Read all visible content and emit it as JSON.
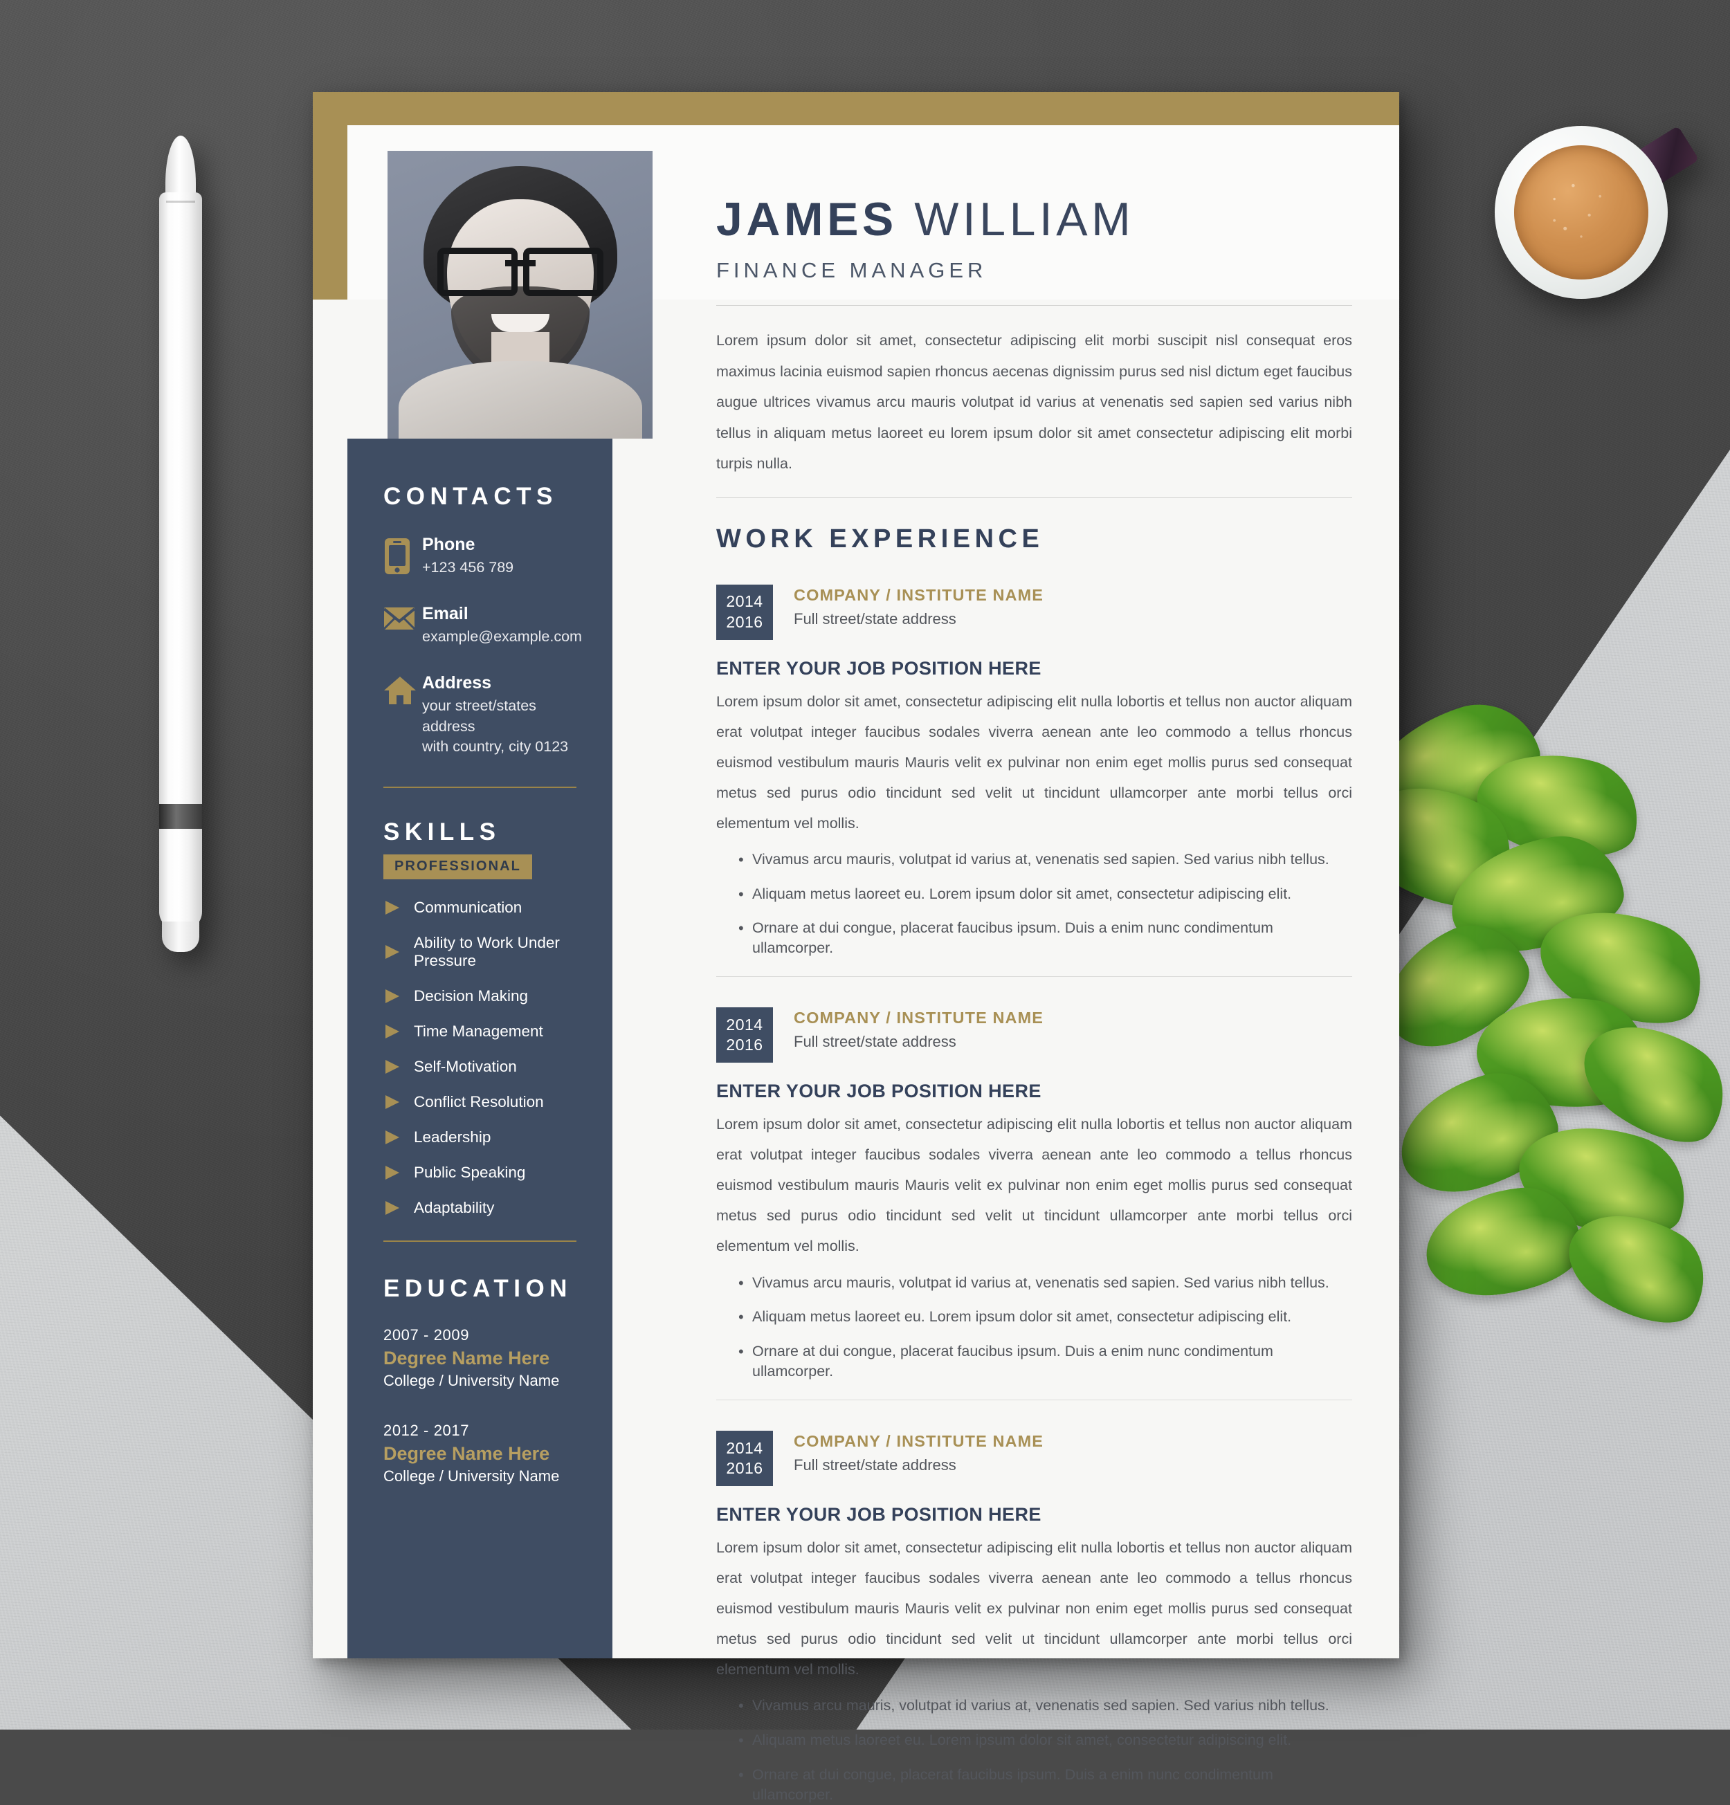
{
  "scene": {
    "objects": [
      {
        "name": "stylus",
        "color": "#ffffff"
      },
      {
        "name": "coffee-cup",
        "color": "#ffffff",
        "handle_color": "#3a2337",
        "coffee_color": "#c9894a"
      },
      {
        "name": "pothos-plant",
        "color": "#4a9620"
      }
    ],
    "desk_dark_color": "#474747",
    "desk_light_color": "#cfd1d2"
  },
  "resume": {
    "colors": {
      "gold": "#a89055",
      "navy": "#3f4d63",
      "heading_navy": "#34415a",
      "paper": "#f7f7f5",
      "body_text": "#53565c"
    },
    "header": {
      "name_first": "JAMES",
      "name_last": "WILLIAM",
      "job_title": "FINANCE MANAGER",
      "photo_alt": "portrait-photo"
    },
    "summary": "Lorem ipsum dolor sit amet, consectetur adipiscing elit morbi suscipit nisl consequat eros maximus lacinia euismod sapien rhoncus aecenas dignissim purus sed nisl dictum eget faucibus augue ultrices vivamus arcu mauris volutpat id varius at venenatis sed sapien sed varius nibh tellus in aliquam metus laoreet eu lorem ipsum dolor sit amet consectetur adipiscing elit morbi turpis nulla.",
    "sidebar": {
      "contacts": {
        "heading": "CONTACTS",
        "items": [
          {
            "icon": "phone-icon",
            "label": "Phone",
            "value": "+123 456 789"
          },
          {
            "icon": "envelope-icon",
            "label": "Email",
            "value": "example@example.com"
          },
          {
            "icon": "home-icon",
            "label": "Address",
            "value": "your street/states address\nwith country, city 0123"
          }
        ]
      },
      "skills": {
        "heading": "SKILLS",
        "tag": "PROFESSIONAL",
        "items": [
          "Communication",
          "Ability to Work Under Pressure",
          "Decision Making",
          "Time Management",
          "Self-Motivation",
          "Conflict Resolution",
          "Leadership",
          "Public Speaking",
          "Adaptability"
        ]
      },
      "education": {
        "heading": "EDUCATION",
        "items": [
          {
            "years": "2007 - 2009",
            "degree": "Degree Name Here",
            "school": "College / University Name"
          },
          {
            "years": "2012 - 2017",
            "degree": "Degree Name Here",
            "school": "College / University Name"
          }
        ]
      }
    },
    "work": {
      "heading": "WORK EXPERIENCE",
      "entries": [
        {
          "year_start": "2014",
          "year_end": "2016",
          "company": "COMPANY / INSTITUTE NAME",
          "address": "Full street/state address",
          "position": "ENTER YOUR JOB POSITION HERE",
          "body": "Lorem ipsum dolor sit amet, consectetur adipiscing elit nulla lobortis et tellus non auctor aliquam erat volutpat integer faucibus sodales viverra aenean ante leo commodo a tellus rhoncus euismod vestibulum mauris Mauris velit ex pulvinar non enim eget mollis purus sed consequat metus sed purus odio tincidunt sed velit ut tincidunt ullamcorper ante morbi tellus orci elementum vel mollis.",
          "bullets": [
            "Vivamus arcu mauris, volutpat id varius at, venenatis sed sapien. Sed varius nibh tellus.",
            "Aliquam metus laoreet eu. Lorem ipsum dolor sit amet, consectetur adipiscing elit.",
            "Ornare at dui congue, placerat faucibus ipsum. Duis a enim nunc condimentum ullamcorper."
          ]
        },
        {
          "year_start": "2014",
          "year_end": "2016",
          "company": "COMPANY / INSTITUTE NAME",
          "address": "Full street/state address",
          "position": "ENTER YOUR JOB POSITION HERE",
          "body": "Lorem ipsum dolor sit amet, consectetur adipiscing elit nulla lobortis et tellus non auctor aliquam erat volutpat integer faucibus sodales viverra aenean ante leo commodo a tellus rhoncus euismod vestibulum mauris Mauris velit ex pulvinar non enim eget mollis purus sed consequat metus sed purus odio tincidunt sed velit ut tincidunt ullamcorper ante morbi tellus orci elementum vel mollis.",
          "bullets": [
            "Vivamus arcu mauris, volutpat id varius at, venenatis sed sapien. Sed varius nibh tellus.",
            "Aliquam metus laoreet eu. Lorem ipsum dolor sit amet, consectetur adipiscing elit.",
            "Ornare at dui congue, placerat faucibus ipsum. Duis a enim nunc condimentum ullamcorper."
          ]
        },
        {
          "year_start": "2014",
          "year_end": "2016",
          "company": "COMPANY / INSTITUTE NAME",
          "address": "Full street/state address",
          "position": "ENTER YOUR JOB POSITION HERE",
          "body": "Lorem ipsum dolor sit amet, consectetur adipiscing elit nulla lobortis et tellus non auctor aliquam erat volutpat integer faucibus sodales viverra aenean ante leo commodo a tellus rhoncus euismod vestibulum mauris Mauris velit ex pulvinar non enim eget mollis purus sed consequat metus sed purus odio tincidunt sed velit ut tincidunt ullamcorper ante morbi tellus orci elementum vel mollis.",
          "bullets": [
            "Vivamus arcu mauris, volutpat id varius at, venenatis sed sapien. Sed varius nibh tellus.",
            "Aliquam metus laoreet eu. Lorem ipsum dolor sit amet, consectetur adipiscing elit.",
            "Ornare at dui congue, placerat faucibus ipsum. Duis a enim nunc condimentum ullamcorper."
          ]
        }
      ]
    }
  }
}
